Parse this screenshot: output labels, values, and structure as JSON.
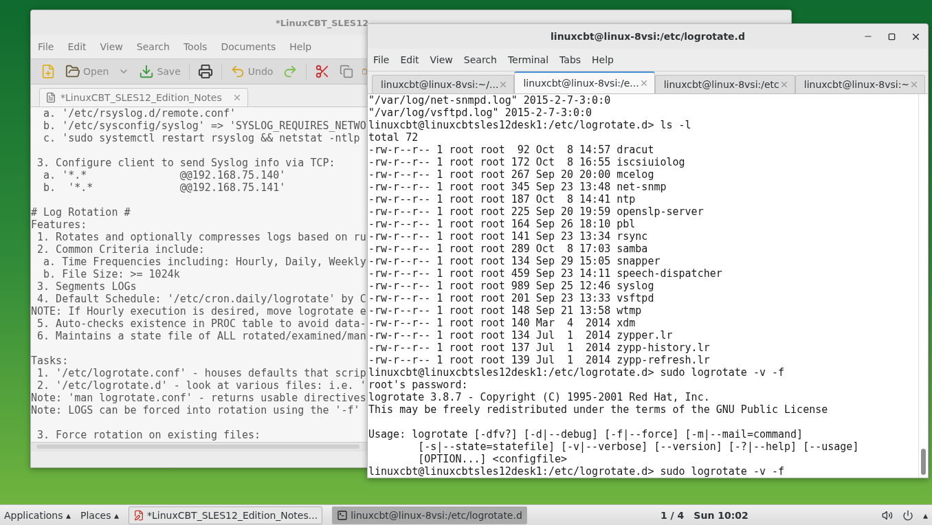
{
  "gedit": {
    "title": "*LinuxCBT_SLES12",
    "menu": [
      "File",
      "Edit",
      "View",
      "Search",
      "Tools",
      "Documents",
      "Help"
    ],
    "toolbar": {
      "open": "Open",
      "save": "Save",
      "undo": "Undo"
    },
    "tab": "*LinuxCBT_SLES12_Edition_Notes",
    "paragraphs": [
      [
        "  a. '/etc/rsyslog.d/remote.conf'",
        "  b. '/etc/sysconfig/syslog' => 'SYSLOG_REQUIRES_NETWO",
        "  c. 'sudo systemctl restart rsyslog && netstat -ntlp"
      ],
      [
        " 3. Configure client to send Syslog info via TCP:",
        "  a. '*.*               @@192.168.75.140'",
        "  b.  '*.*              @@192.168.75.141'"
      ],
      [
        "# Log Rotation #",
        "Features:",
        " 1. Rotates and optionally compresses logs based on ru",
        " 2. Common Criteria include:",
        "  a. Time Frequencies including: Hourly, Daily, Weekly",
        "  b. File Size: >= 1024k",
        " 3. Segments LOGs",
        " 4. Default Schedule: '/etc/cron.daily/logrotate' by C",
        "NOTE: If Hourly execution is desired, move logrotate e",
        " 5. Auto-checks existence in PROC table to avoid data-",
        " 6. Maintains a state file of ALL rotated/examined/man"
      ],
      [
        "Tasks:",
        " 1. '/etc/logrotate.conf' - houses defaults that scrip",
        " 2. '/etc/logrotate.d' - look at various files: i.e. '",
        "Note: 'man logrotate.conf' - returns usable directives",
        "Note: LOGS can be forced into rotation using the '-f'"
      ],
      [
        " 3. Force rotation on existing files:"
      ]
    ]
  },
  "terminal": {
    "title": "linuxcbt@linux-8vsi:/etc/logrotate.d",
    "menu": [
      "File",
      "Edit",
      "View",
      "Search",
      "Terminal",
      "Tabs",
      "Help"
    ],
    "tabs": [
      {
        "label": "linuxcbt@linux-8vsi:~/...",
        "selected": false
      },
      {
        "label": "linuxcbt@linux-8vsi:/e...",
        "selected": true
      },
      {
        "label": "linuxcbt@linux-8vsi:/etc",
        "selected": false
      },
      {
        "label": "linuxcbt@linux-8vsi:~",
        "selected": false
      }
    ],
    "paragraphs": [
      [
        "\"/var/log/net-snmpd.log\" 2015-2-7-3:0:0",
        "\"/var/log/vsftpd.log\" 2015-2-7-3:0:0",
        "linuxcbt@linuxcbtsles12desk1:/etc/logrotate.d> ls -l",
        "total 72",
        "-rw-r--r-- 1 root root  92 Oct  8 14:57 dracut",
        "-rw-r--r-- 1 root root 172 Oct  8 16:55 iscsiuiolog",
        "-rw-r--r-- 1 root root 267 Sep 20 20:00 mcelog",
        "-rw-r--r-- 1 root root 345 Sep 23 13:48 net-snmp",
        "-rw-r--r-- 1 root root 187 Oct  8 14:41 ntp",
        "-rw-r--r-- 1 root root 225 Sep 20 19:59 openslp-server",
        "-rw-r--r-- 1 root root 164 Sep 26 18:10 pbl",
        "-rw-r--r-- 1 root root 141 Sep 23 13:34 rsync",
        "-rw-r--r-- 1 root root 289 Oct  8 17:03 samba",
        "-rw-r--r-- 1 root root 134 Sep 29 15:05 snapper",
        "-rw-r--r-- 1 root root 459 Sep 23 14:11 speech-dispatcher",
        "-rw-r--r-- 1 root root 989 Sep 25 12:46 syslog",
        "-rw-r--r-- 1 root root 201 Sep 23 13:33 vsftpd",
        "-rw-r--r-- 1 root root 148 Sep 21 13:58 wtmp",
        "-rw-r--r-- 1 root root 140 Mar  4  2014 xdm",
        "-rw-r--r-- 1 root root 134 Jul  1  2014 zypper.lr",
        "-rw-r--r-- 1 root root 137 Jul  1  2014 zypp-history.lr",
        "-rw-r--r-- 1 root root 139 Jul  1  2014 zypp-refresh.lr",
        "linuxcbt@linuxcbtsles12desk1:/etc/logrotate.d> sudo logrotate -v -f",
        "root's password:",
        "logrotate 3.8.7 - Copyright (C) 1995-2001 Red Hat, Inc.",
        "This may be freely redistributed under the terms of the GNU Public License"
      ],
      [
        "Usage: logrotate [-dfv?] [-d|--debug] [-f|--force] [-m|--mail=command]",
        "        [-s|--state=statefile] [-v|--verbose] [--version] [-?|--help] [--usage]",
        "        [OPTION...] <configfile>",
        "linuxcbt@linuxcbtsles12desk1:/etc/logrotate.d> sudo logrotate -v -f"
      ]
    ]
  },
  "taskbar": {
    "menus": [
      "Applications ▴",
      "Places ▴"
    ],
    "tasks": [
      {
        "kind": "editor",
        "label": "*LinuxCBT_SLES12_Edition_Notes...",
        "selected": false
      },
      {
        "kind": "terminal",
        "label": "linuxcbt@linux-8vsi:/etc/logrotate.d",
        "selected": true
      }
    ],
    "workspace": "1 / 4",
    "clock": "Sun 10:02",
    "tray_arrow": "▴"
  }
}
